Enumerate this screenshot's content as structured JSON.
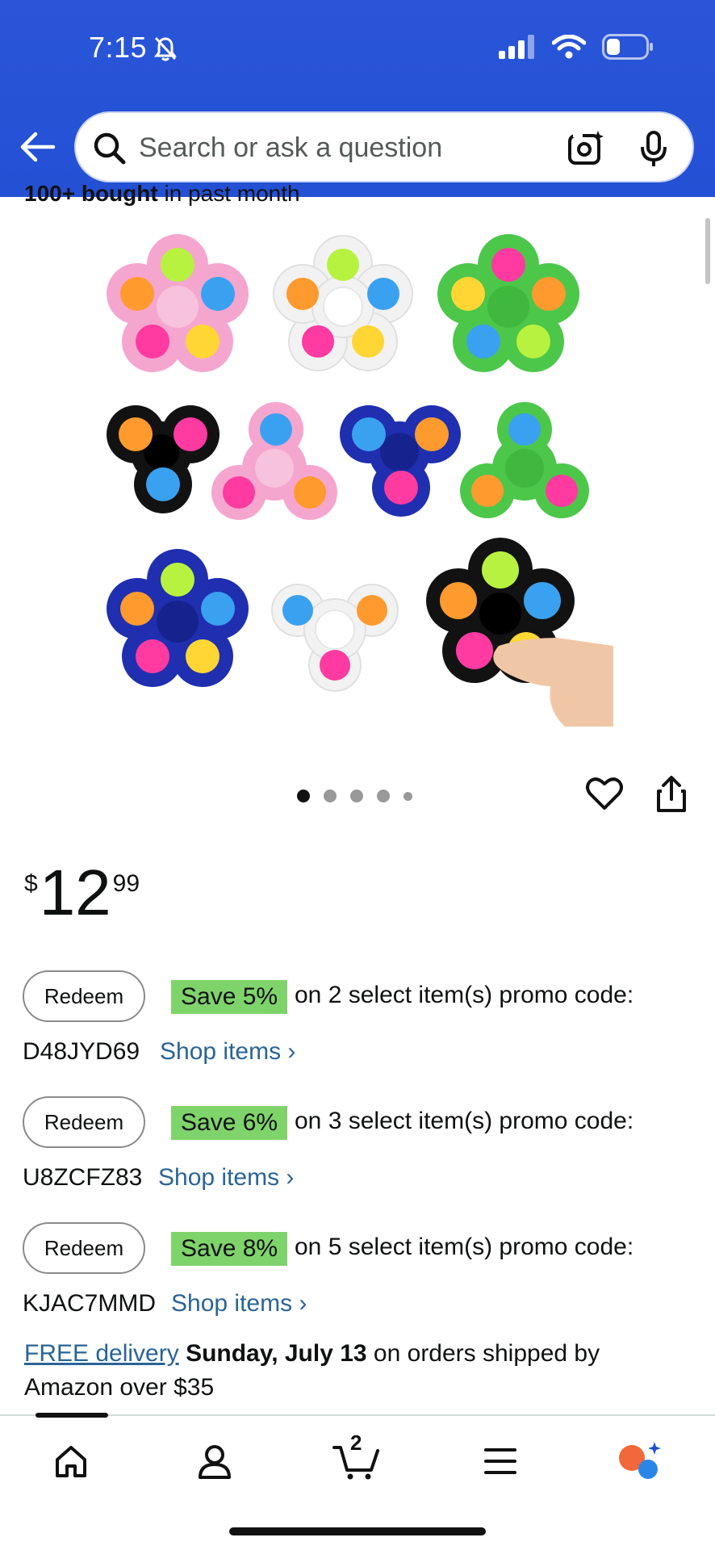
{
  "status_bar": {
    "time": "7:15"
  },
  "search": {
    "placeholder": "Search or ask a question"
  },
  "bought": {
    "bold": "100+ bought",
    "rest": " in past month"
  },
  "carousel": {
    "total_images": 5,
    "active_index": 0
  },
  "price": {
    "currency": "$",
    "whole": "12",
    "fraction": "99"
  },
  "promos": [
    {
      "redeem_label": "Redeem",
      "save": "Save 5%",
      "desc": "on 2 select item(s) promo code:",
      "code": "D48JYD69",
      "shop_label": "Shop items ›"
    },
    {
      "redeem_label": "Redeem",
      "save": "Save 6%",
      "desc": "on 3 select item(s) promo code:",
      "code": "U8ZCFZ83",
      "shop_label": "Shop items ›"
    },
    {
      "redeem_label": "Redeem",
      "save": "Save 8%",
      "desc": "on 5 select item(s) promo code:",
      "code": "KJAC7MMD",
      "shop_label": "Shop items ›"
    }
  ],
  "delivery": {
    "free_label": "FREE delivery",
    "date": "Sunday, July 13",
    "rest": " on orders shipped by Amazon over $35"
  },
  "nav": {
    "cart_count": "2"
  },
  "colors": {
    "header_blue": "#2350d4",
    "save_green": "#7fd36b",
    "link_blue": "#2a6496"
  }
}
